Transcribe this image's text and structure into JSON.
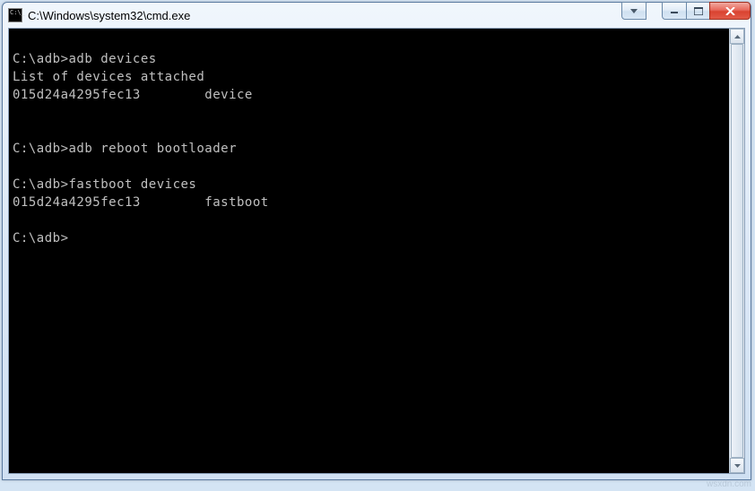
{
  "window": {
    "title": "C:\\Windows\\system32\\cmd.exe"
  },
  "terminal": {
    "lines": [
      "",
      "C:\\adb>adb devices",
      "List of devices attached",
      "015d24a4295fec13        device",
      "",
      "",
      "C:\\adb>adb reboot bootloader",
      "",
      "C:\\adb>fastboot devices",
      "015d24a4295fec13        fastboot",
      "",
      "C:\\adb>"
    ]
  },
  "watermark": "wsxdn.com"
}
